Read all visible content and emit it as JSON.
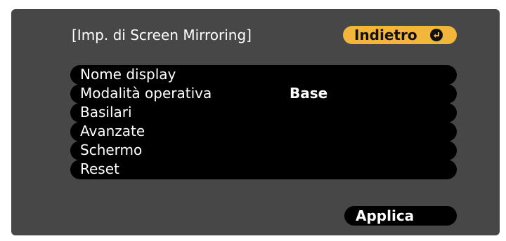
{
  "panel": {
    "title": "[Imp. di Screen Mirroring]",
    "back_button": {
      "label": "Indietro",
      "icon": "enter-icon"
    },
    "menu_items": [
      {
        "label": "Nome display",
        "value": ""
      },
      {
        "label": "Modalità operativa",
        "value": "Base"
      },
      {
        "label": "Basilari",
        "value": ""
      },
      {
        "label": "Avanzate",
        "value": ""
      },
      {
        "label": "Schermo",
        "value": ""
      },
      {
        "label": "Reset",
        "value": ""
      }
    ],
    "apply_button": {
      "label": "Applica"
    },
    "colors": {
      "panel_bg": "#474747",
      "item_bg": "#000000",
      "highlight": "#f2b63c",
      "text": "#ffffff"
    }
  }
}
